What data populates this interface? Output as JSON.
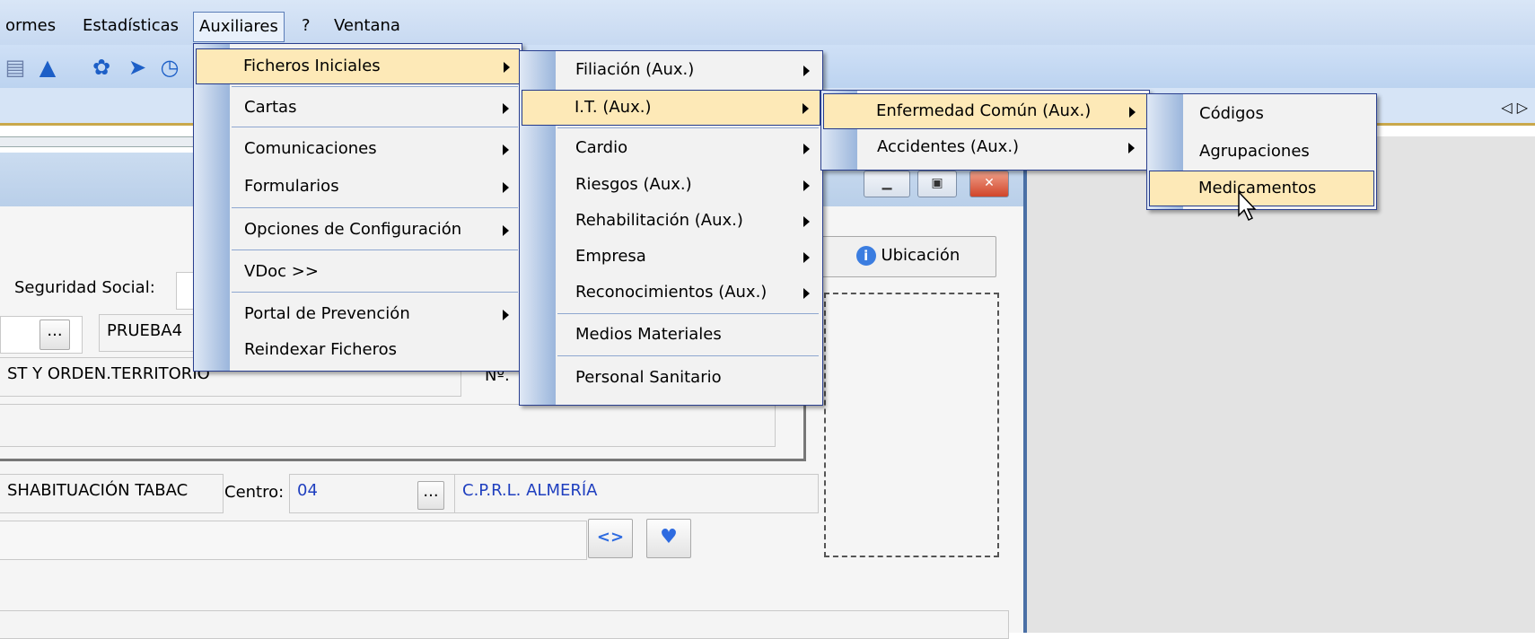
{
  "menubar": {
    "items": [
      "ormes",
      "Estadísticas",
      "Auxiliares",
      "?",
      "Ventana"
    ]
  },
  "toolbar": {
    "icons": [
      "notes-icon",
      "warning-icon",
      "gear-icon",
      "send-icon",
      "clock-icon"
    ]
  },
  "form": {
    "seguridad_label": "Seguridad Social:",
    "prueba": "PRUEBA4",
    "ellipsis": "...",
    "territorio": "ST Y ORDEN.TERRITORIO",
    "no_label": "Nº.",
    "tabac": "SHABITUACIÓN TABAC",
    "centro_label": "Centro:",
    "centro_code": "04",
    "centro_name": "C.P.R.L. ALMERÍA",
    "ubicacion": "Ubicación"
  },
  "menus": {
    "auxiliares": [
      "Ficheros Iniciales",
      "Cartas",
      "Comunicaciones",
      "Formularios",
      "Opciones de Configuración",
      "VDoc >>",
      "Portal de Prevención",
      "Reindexar Ficheros"
    ],
    "ficheros": [
      "Filiación (Aux.)",
      "I.T. (Aux.)",
      "Cardio",
      "Riesgos (Aux.)",
      "Rehabilitación (Aux.)",
      "Empresa",
      "Reconocimientos (Aux.)",
      "Medios Materiales",
      "Personal Sanitario"
    ],
    "it": [
      "Enfermedad Común (Aux.)",
      "Accidentes (Aux.)"
    ],
    "enfermedad": [
      "Códigos",
      "Agrupaciones",
      "Medicamentos"
    ]
  },
  "colors": {
    "highlight": "#fde9b7",
    "menu_border": "#2a3f8f",
    "accent": "#1d5fc7"
  }
}
